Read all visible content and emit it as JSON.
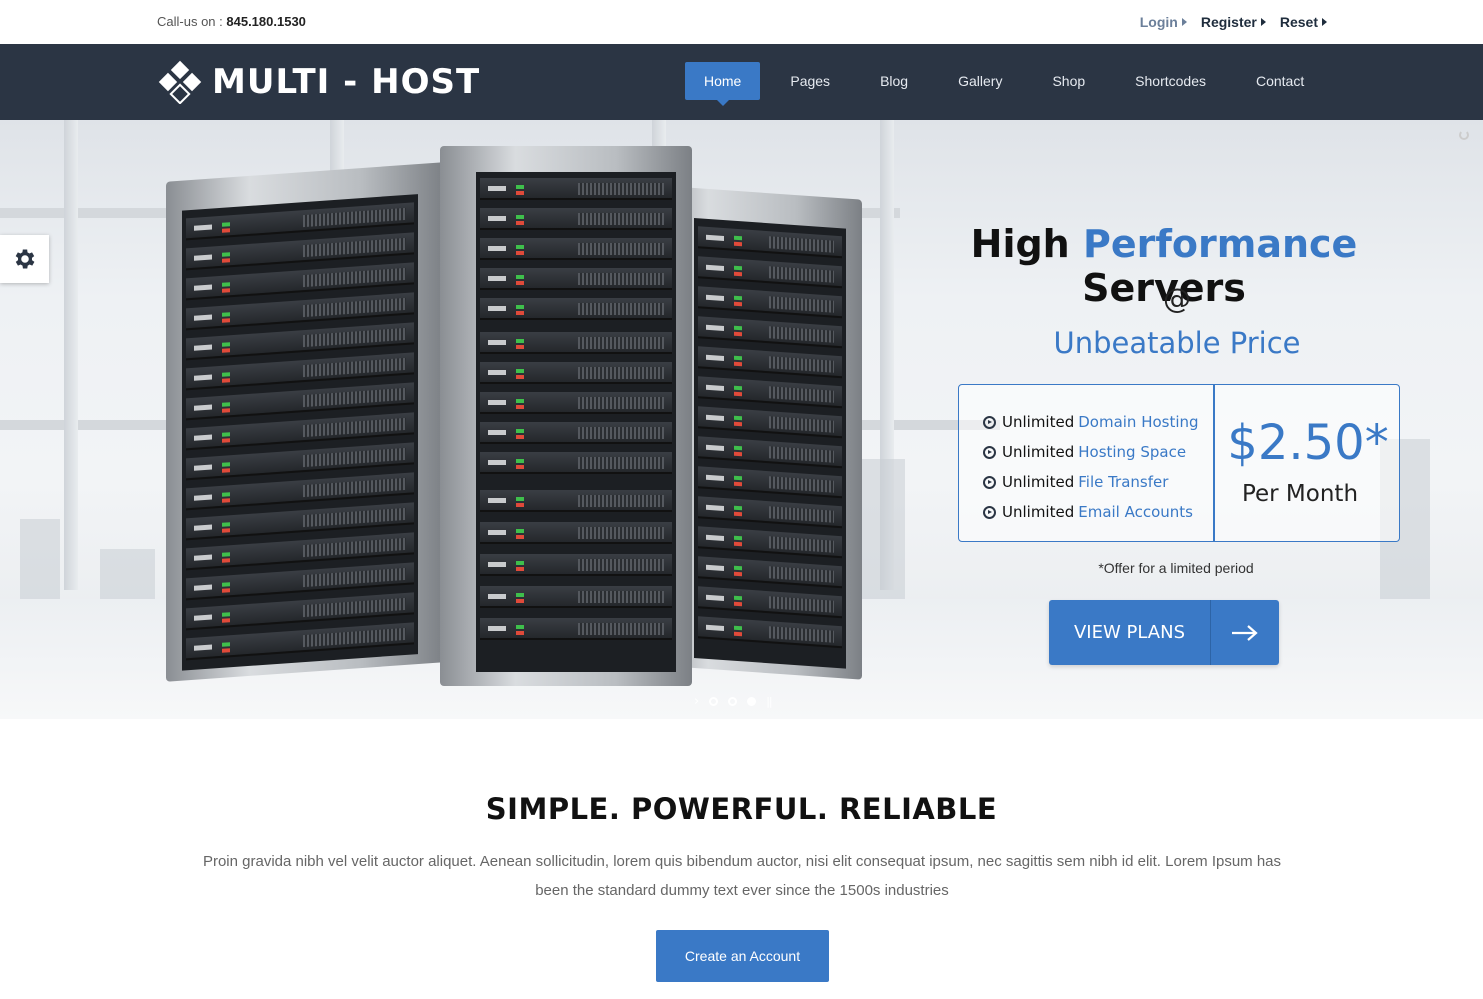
{
  "topbar": {
    "callus_label": "Call-us on :",
    "phone": "845.180.1530",
    "links": [
      "Login",
      "Register",
      "Reset"
    ]
  },
  "brand": {
    "name": "MULTI - HOST"
  },
  "nav": {
    "items": [
      "Home",
      "Pages",
      "Blog",
      "Gallery",
      "Shop",
      "Shortcodes",
      "Contact"
    ],
    "active": "Home"
  },
  "hero": {
    "title_part1": "High",
    "title_part2": "Performance",
    "title_part3": "Servers",
    "at": "@",
    "subtitle": "Unbeatable Price",
    "features": [
      {
        "prefix": "Unlimited",
        "highlight": "Domain Hosting"
      },
      {
        "prefix": "Unlimited",
        "highlight": "Hosting Space"
      },
      {
        "prefix": "Unlimited",
        "highlight": "File Transfer"
      },
      {
        "prefix": "Unlimited",
        "highlight": "Email Accounts"
      }
    ],
    "price": "$2.50*",
    "period": "Per Month",
    "offer_note": "*Offer for a limited period",
    "cta_label": "VIEW PLANS",
    "slides_total": 3,
    "slide_active": 3
  },
  "section": {
    "title": "SIMPLE. POWERFUL. RELIABLE",
    "text": "Proin gravida nibh vel velit auctor aliquet. Aenean sollicitudin, lorem quis bibendum auctor, nisi elit consequat ipsum, nec sagittis sem nibh id elit. Lorem Ipsum has been the  standard dummy text ever since the 1500s industries",
    "button_label": "Create an Account"
  },
  "colors": {
    "accent": "#3a79c6",
    "nav_bg": "#2b3544"
  },
  "icons": {
    "settings": "gear-icon",
    "cta": "arrow-right-icon",
    "feature_bullet": "circle-chevron-right-icon",
    "brand": "diamond-logo-icon"
  }
}
